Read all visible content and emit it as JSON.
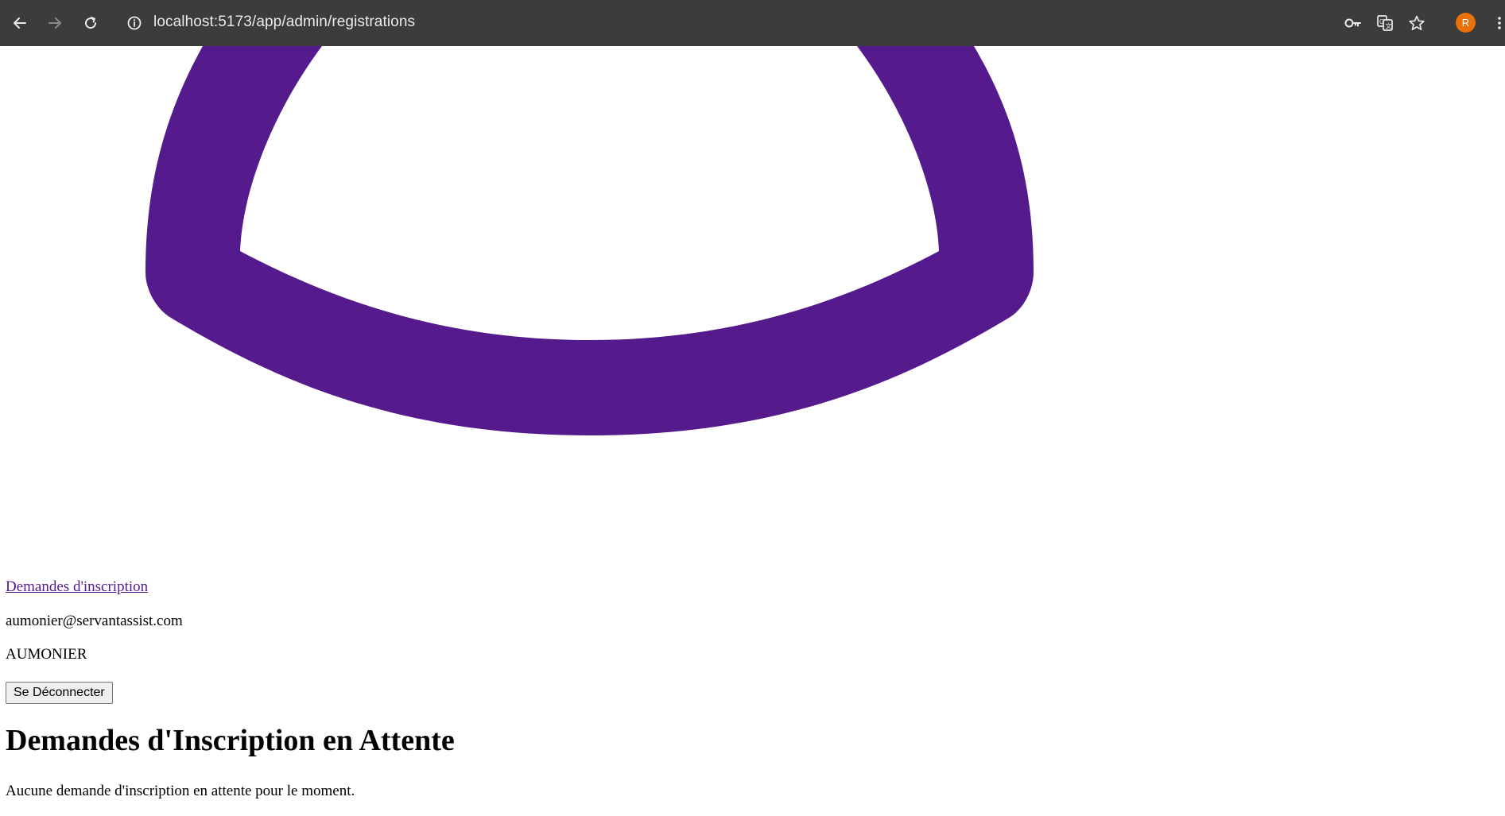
{
  "browser": {
    "url": "localhost:5173/app/admin/registrations",
    "profile_initial": "R"
  },
  "icons": {
    "back": "arrow-left-icon",
    "forward": "arrow-right-icon",
    "reload": "reload-icon",
    "site_info": "info-icon",
    "passwords": "key-icon",
    "translate": "translate-icon",
    "bookmark": "star-icon",
    "menu": "kebab-menu-icon"
  },
  "colors": {
    "logo": "#551a8b",
    "link": "#551a8b",
    "toolbar": "#3c3c3c",
    "avatar": "#e8710a"
  },
  "nav": {
    "registrations_link": "Demandes d'inscription"
  },
  "user": {
    "email": "aumonier@servantassist.com",
    "role": "AUMONIER"
  },
  "actions": {
    "logout_label": "Se Déconnecter"
  },
  "main": {
    "title": "Demandes d'Inscription en Attente",
    "empty_message": "Aucune demande d'inscription en attente pour le moment."
  }
}
